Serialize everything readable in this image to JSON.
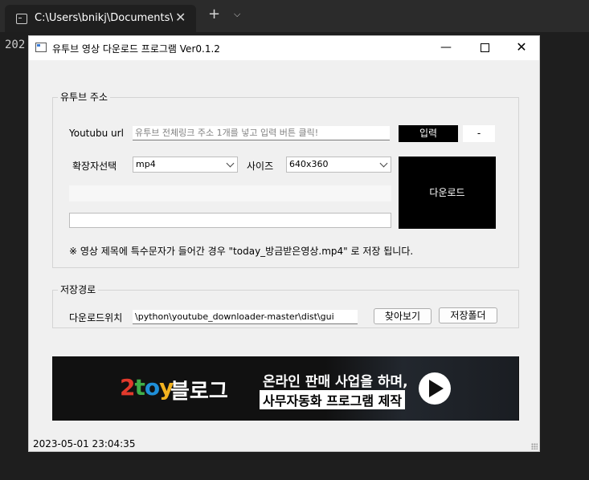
{
  "terminal": {
    "tab_title": "C:\\Users\\bnikj\\Documents\\",
    "tab_close": "✕",
    "new_tab": "+",
    "dropdown": "⌵",
    "text": "202"
  },
  "window": {
    "title": "유투브 영상 다운로드 프로그램 Ver0.1.2",
    "min": "—",
    "close": "✕"
  },
  "youtube_group": {
    "label": "유투브 주소",
    "url_label": "Youtubu url",
    "url_placeholder": "유투브 전체링크 주소 1개를 넣고 입력 버튼 클릭!",
    "input_button": "입력",
    "dash_button": "-",
    "ext_label": "확장자선택",
    "ext_value": "mp4",
    "size_label": "사이즈",
    "size_value": "640x360",
    "download_button": "다운로드",
    "note": "※ 영상 제목에 특수문자가 들어간 경우 \"today_방금받은영상.mp4\" 로 저장 됩니다."
  },
  "save_group": {
    "label": "저장경로",
    "location_label": "다운로드위치",
    "location_value": "\\python\\youtube_downloader-master\\dist\\gui",
    "browse_button": "찾아보기",
    "folder_button": "저장폴더"
  },
  "banner": {
    "brand_2": "2",
    "brand_t": "t",
    "brand_o": "o",
    "brand_y": "y",
    "blog": "블로그",
    "line1": "온라인 판매 사업을 하며,",
    "line2": "사무자동화 프로그램 제작"
  },
  "status": {
    "datetime": "2023-05-01 23:04:35"
  }
}
